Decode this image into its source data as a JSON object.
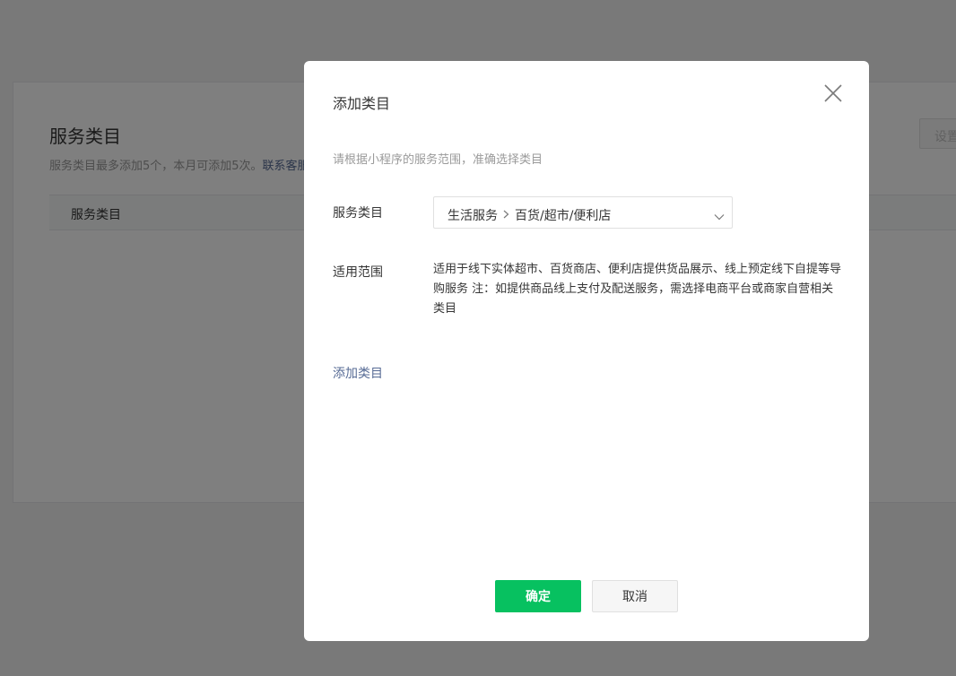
{
  "background": {
    "title": "服务类目",
    "desc_text": "服务类目最多添加5个，本月可添加5次。",
    "desc_link": "联系客服",
    "table_header": "服务类目",
    "setting_button": "设置"
  },
  "dialog": {
    "title": "添加类目",
    "tip": "请根据小程序的服务范围，准确选择类目",
    "category_label": "服务类目",
    "category_level1": "生活服务",
    "category_level2": "百货/超市/便利店",
    "scope_label": "适用范围",
    "scope_text": "适用于线下实体超市、百货商店、便利店提供货品展示、线上预定线下自提等导购服务 注：如提供商品线上支付及配送服务，需选择电商平台或商家自营相关类目",
    "add_link": "添加类目",
    "confirm_button": "确定",
    "cancel_button": "取消"
  },
  "icons": {
    "close": "close-icon",
    "chevron_right": "chevron-right-icon",
    "chevron_down": "chevron-down-icon"
  },
  "colors": {
    "primary": "#07c160",
    "link": "#576b95",
    "mask": "rgba(0,0,0,0.5)"
  }
}
